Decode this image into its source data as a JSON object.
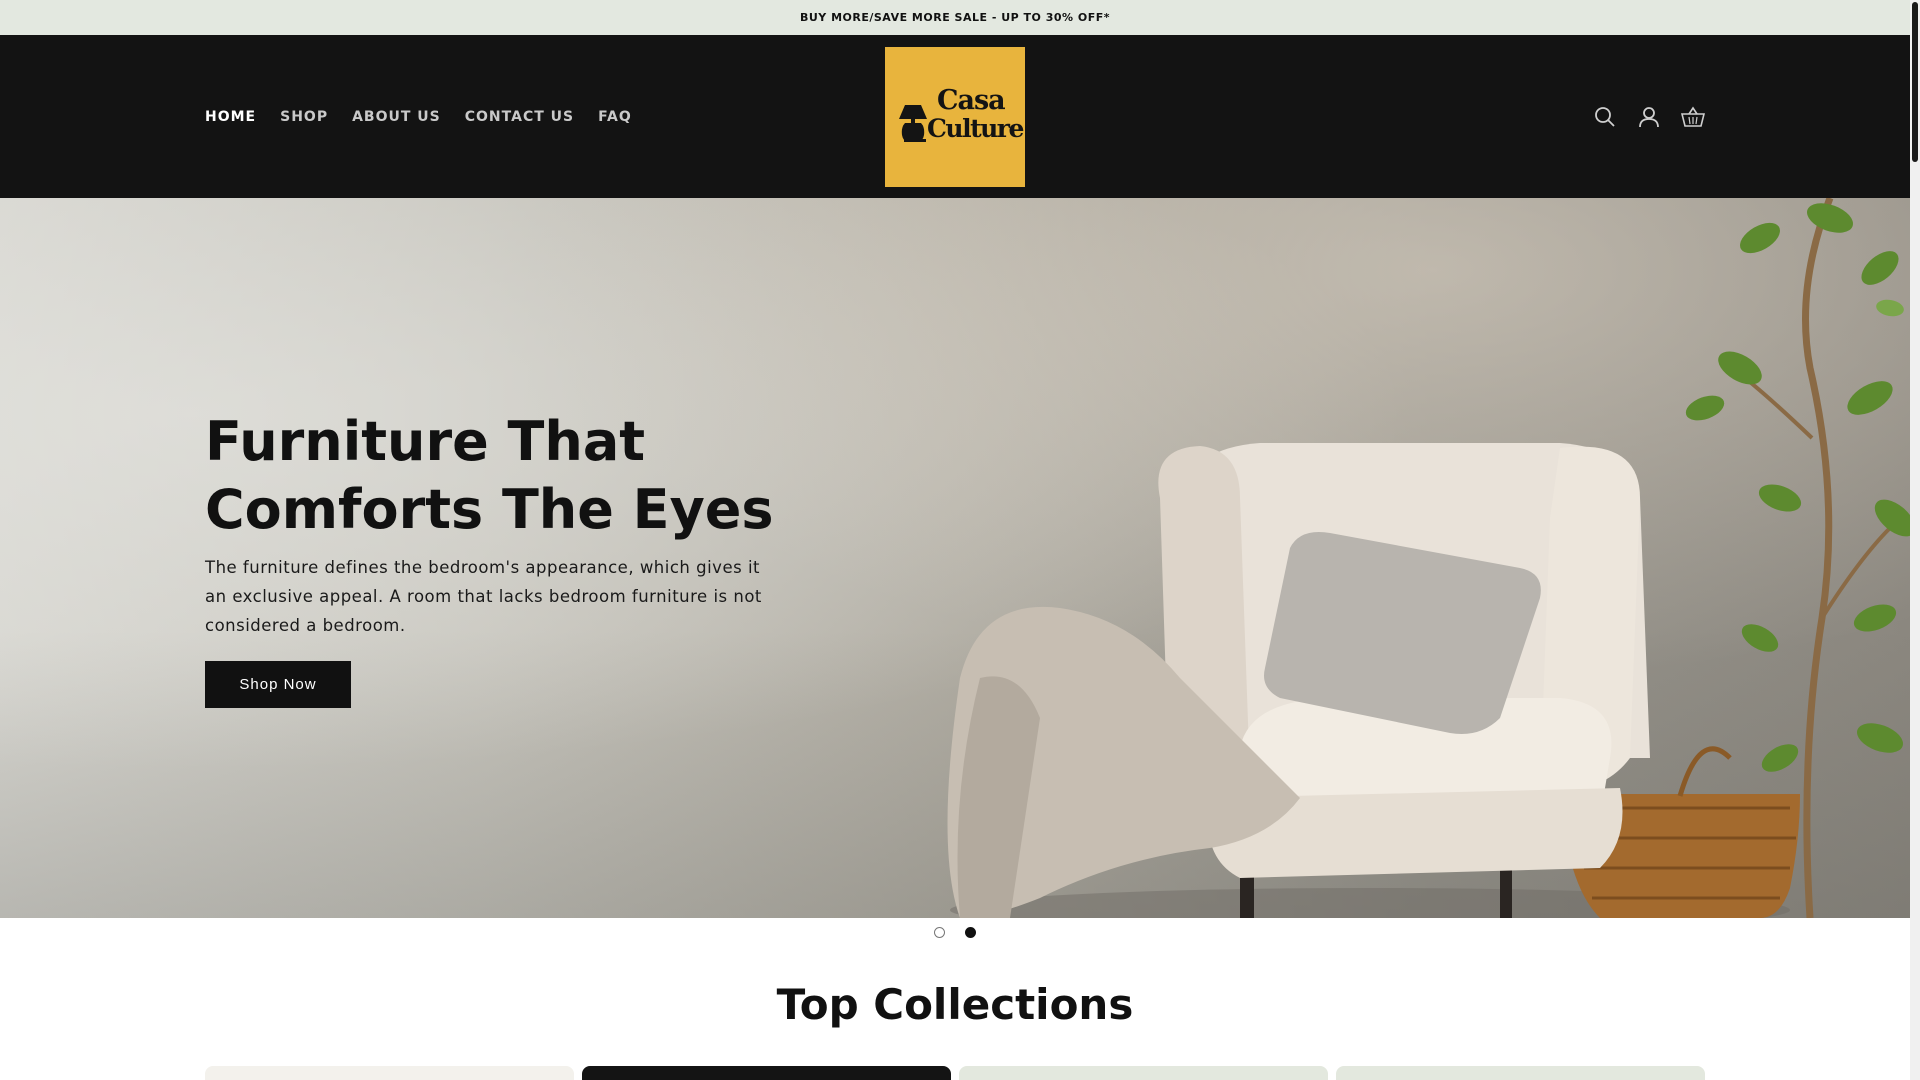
{
  "announcement": {
    "text": "BUY MORE/SAVE MORE SALE - UP TO 30% OFF*"
  },
  "header": {
    "nav": [
      {
        "label": "HOME",
        "active": true
      },
      {
        "label": "SHOP",
        "active": false
      },
      {
        "label": "ABOUT US",
        "active": false
      },
      {
        "label": "CONTACT US",
        "active": false
      },
      {
        "label": "FAQ",
        "active": false
      }
    ],
    "logo": {
      "line1": "Casa",
      "line2": "Culture",
      "bg_color": "#e8b43d"
    },
    "icons": [
      "search-icon",
      "account-icon",
      "cart-icon"
    ]
  },
  "hero": {
    "title": "Furniture That Comforts The Eyes",
    "subtitle": "The furniture defines the bedroom's appearance, which gives it an exclusive appeal. A room that lacks bedroom furniture is not considered a bedroom.",
    "button_label": "Shop Now"
  },
  "slider": {
    "total": 2,
    "active_index": 2
  },
  "collections": {
    "title": "Top Collections",
    "card_colors": [
      "#f3f1ec",
      "#141414",
      "#e3e8de",
      "#e3e8de"
    ]
  },
  "colors": {
    "header_bg": "#131313",
    "announce_bg": "#e3e8e0",
    "accent": "#e8b43d"
  }
}
